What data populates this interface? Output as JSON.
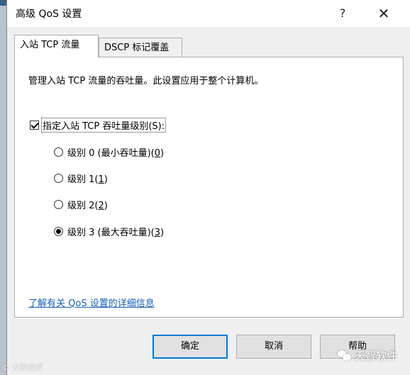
{
  "window": {
    "title": "高级 QoS 设置",
    "help_glyph": "?",
    "close_glyph": "✕"
  },
  "tabs": [
    {
      "label": "入站 TCP 流量",
      "active": true
    },
    {
      "label": "DSCP 标记覆盖",
      "active": false
    }
  ],
  "panel": {
    "description": "管理入站 TCP 流量的吞吐量。此设置应用于整个计算机。",
    "checkbox": {
      "label": "指定入站 TCP 吞吐量级别(S):",
      "checked": true
    },
    "radios": [
      {
        "prefix": "级别 0 (最小吞吐量)(",
        "key": "0",
        "suffix": ")",
        "checked": false
      },
      {
        "prefix": "级别 1(",
        "key": "1",
        "suffix": ")",
        "checked": false
      },
      {
        "prefix": "级别 2(",
        "key": "2",
        "suffix": ")",
        "checked": false
      },
      {
        "prefix": "级别 3 (最大吞吐量)(",
        "key": "3",
        "suffix": ")",
        "checked": true
      }
    ],
    "link": "了解有关 QoS 设置的详细信息"
  },
  "buttons": {
    "ok": "确定",
    "cancel": "取消",
    "help": "帮助"
  },
  "watermarks": {
    "left": "© 大熊视界",
    "right": "天智软件"
  }
}
